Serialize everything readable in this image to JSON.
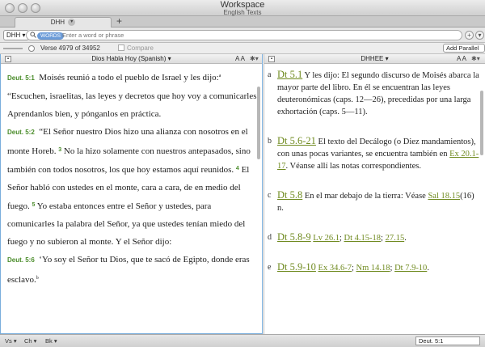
{
  "window": {
    "title": "Workspace",
    "subtitle": "English Texts"
  },
  "tabs": [
    {
      "label": "DHH",
      "dropdown": "▾"
    }
  ],
  "tab_add": "+",
  "search": {
    "book_button": "DHH ▾",
    "chip": "WORDS",
    "placeholder": "Enter a word or phrase",
    "add_icon": "+",
    "menu_icon": "▾"
  },
  "slider_row": {
    "verse_count": "Verse 4979 of 34952",
    "compare_label": "Compare",
    "add_parallel": "Add Parallel ▾"
  },
  "left_pane": {
    "header": {
      "title": "Dios Habla Hoy (Spanish) ▾",
      "font_label": "A A",
      "gear": "✱▾"
    },
    "paragraphs": [
      {
        "ref": "Deut. 5:1",
        "text": "Moisés reunió a todo el pueblo de Israel y les dijo:",
        "footnote": "a"
      },
      {
        "ref": "",
        "text": "“Escuchen, israelitas, las leyes y decretos que hoy voy a comunicarles. Aprendanlos bien, y pónganlos en práctica."
      },
      {
        "ref": "Deut. 5:2",
        "text": "“El Señor nuestro Dios hizo una alianza con nosotros en el monte Horeb.",
        "v3": "3",
        "t3": "No la hizo solamente con nuestros antepasados, sino también con todos nosotros, los que hoy estamos aquí reunidos.",
        "v4": "4",
        "t4": "El Señor habló con ustedes en el monte, cara a cara, de en medio del fuego.",
        "v5": "5",
        "t5": "Yo estaba entonces entre el Señor y ustedes, para comunicarles la palabra del Señor, ya que ustedes tenían miedo del fuego y no subieron al monte. Y el Señor dijo:"
      },
      {
        "ref": "Deut. 5:6",
        "text": "‘Yo soy el Señor tu Dios, que te sacó de Egipto, donde eras esclavo.",
        "footnote": "b"
      }
    ]
  },
  "right_pane": {
    "header": {
      "title": "DHHEE ▾",
      "font_label": "A A",
      "gear": "✱▾"
    },
    "notes": [
      {
        "letter": "a",
        "ref": "Dt 5.1",
        "text": "Y les dijo:  El segundo discurso de Moisés abarca la mayor parte del libro. En él se encuentran las leyes deuteronómicas (caps. 12—26), precedidas por una larga exhortación (caps. 5—11)."
      },
      {
        "letter": "b",
        "ref": "Dt 5.6-21",
        "text": "El texto del Decálogo (o Diez mandamientos), con unas pocas variantes, se encuentra también en",
        "link2": "Ex 20.1-17",
        "text2": ". Véanse allí las notas correspondientes."
      },
      {
        "letter": "c",
        "ref": "Dt 5.8",
        "text": "En el mar debajo de la tierra:  Véase",
        "link2": "Sal 18.15",
        "text2": "(16) n."
      },
      {
        "letter": "d",
        "ref": "Dt 5.8-9",
        "links": [
          "Lv 26.1",
          "Dt 4.15-18",
          "27.15"
        ]
      },
      {
        "letter": "e",
        "ref": "Dt 5.9-10",
        "links": [
          "Ex 34.6-7",
          "Nm 14.18",
          "Dt 7.9-10"
        ]
      }
    ]
  },
  "statusbar": {
    "vs": "Vs ▾",
    "ch": "Ch ▾",
    "bk": "Bk ▾",
    "reference": "Deut. 5:1"
  }
}
